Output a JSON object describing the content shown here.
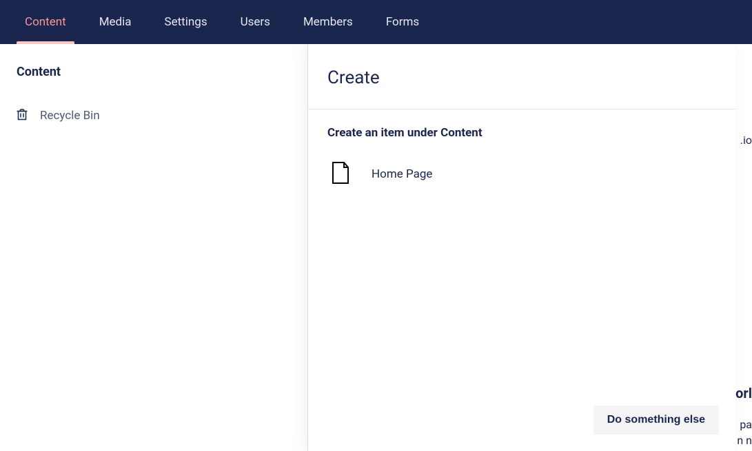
{
  "topnav": {
    "items": [
      {
        "label": "Content",
        "active": true
      },
      {
        "label": "Media",
        "active": false
      },
      {
        "label": "Settings",
        "active": false
      },
      {
        "label": "Users",
        "active": false
      },
      {
        "label": "Members",
        "active": false
      },
      {
        "label": "Forms",
        "active": false
      }
    ]
  },
  "sidebar": {
    "title": "Content",
    "items": [
      {
        "icon": "trash-icon",
        "label": "Recycle Bin"
      }
    ]
  },
  "dialog": {
    "title": "Create",
    "subtitle": "Create an item under Content",
    "options": [
      {
        "icon": "file-icon",
        "label": "Home Page"
      }
    ],
    "footer_button": "Do something else"
  },
  "bg_peek": {
    "line1": ".io",
    "line2": "orl",
    "line3": "pa",
    "line4": "n n"
  }
}
